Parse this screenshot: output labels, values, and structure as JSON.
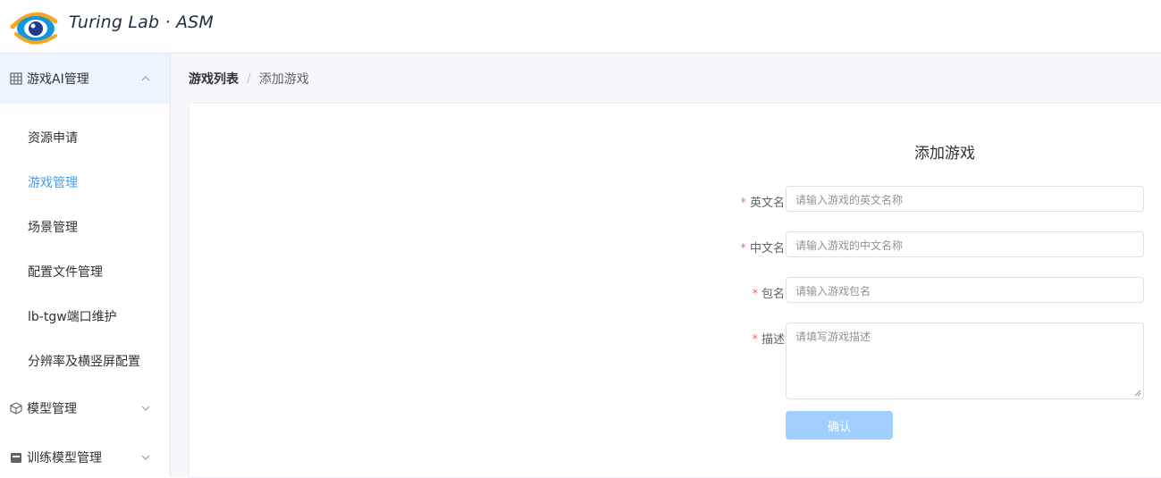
{
  "header": {
    "brand": "Turing Lab · ASM",
    "logo_icon": "eye-logo-icon"
  },
  "sidebar": {
    "groups": [
      {
        "label": "游戏AI管理",
        "icon": "grid-icon",
        "expanded": true,
        "items": [
          {
            "label": "资源申请",
            "active": false
          },
          {
            "label": "游戏管理",
            "active": true
          },
          {
            "label": "场景管理",
            "active": false
          },
          {
            "label": "配置文件管理",
            "active": false
          },
          {
            "label": "lb-tgw端口维护",
            "active": false
          },
          {
            "label": "分辨率及横竖屏配置",
            "active": false
          }
        ]
      },
      {
        "label": "模型管理",
        "icon": "cube-icon",
        "expanded": false
      },
      {
        "label": "训练模型管理",
        "icon": "box-icon",
        "expanded": false
      }
    ]
  },
  "breadcrumb": {
    "items": [
      "游戏列表",
      "添加游戏"
    ],
    "separator": "/"
  },
  "form": {
    "title": "添加游戏",
    "fields": [
      {
        "label": "英文名",
        "required": true,
        "placeholder": "请输入游戏的英文名称",
        "value": ""
      },
      {
        "label": "中文名",
        "required": true,
        "placeholder": "请输入游戏的中文名称",
        "value": ""
      },
      {
        "label": "包名",
        "required": true,
        "placeholder": "请输入游戏包名",
        "value": ""
      },
      {
        "label": "描述",
        "required": true,
        "placeholder": "请填写游戏描述",
        "value": ""
      }
    ],
    "confirm_label": "确认",
    "required_mark": "*"
  },
  "colors": {
    "accent": "#409eff",
    "active_bg": "#ecf5ff",
    "required": "#f56c6c",
    "button_disabled": "#a0cfff"
  }
}
